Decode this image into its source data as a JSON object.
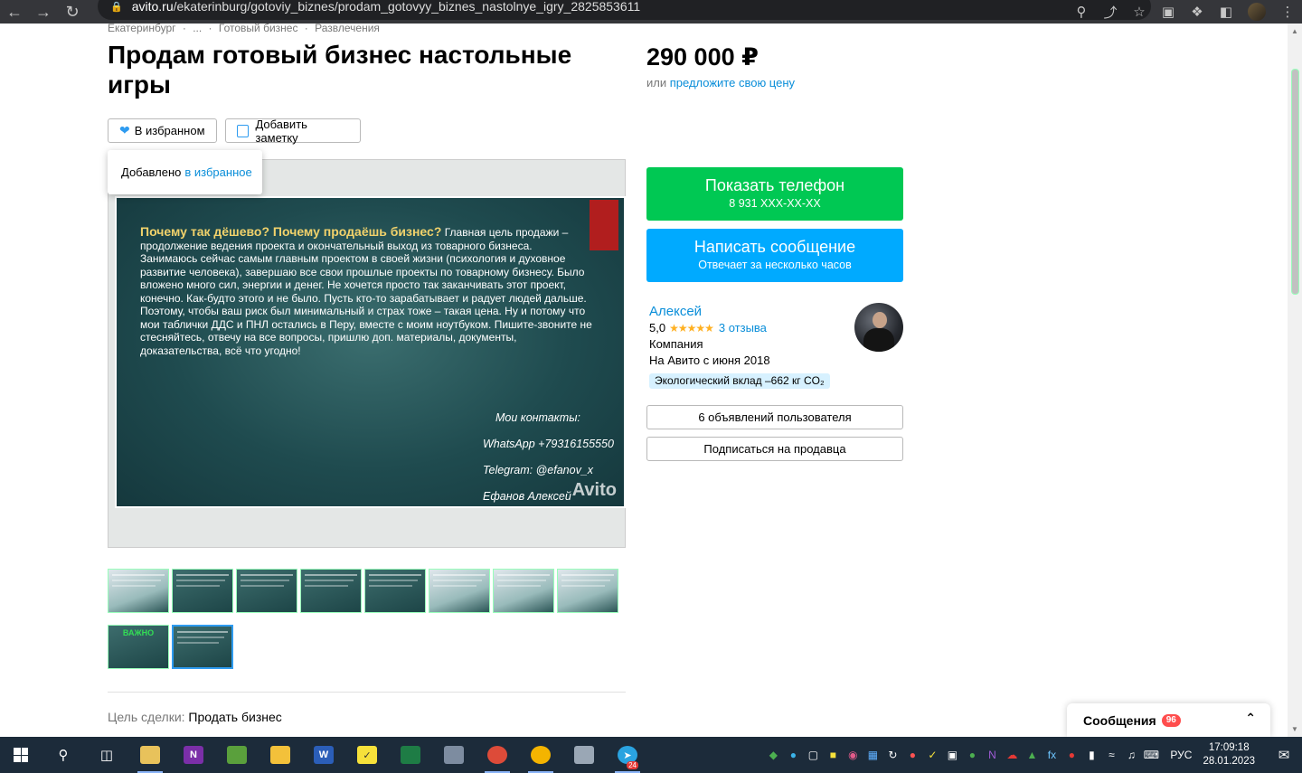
{
  "browser": {
    "url_host": "avito.ru",
    "url_path": "/ekaterinburg/gotoviy_biznes/prodam_gotovyy_biznes_nastolnye_igry_2825853611"
  },
  "breadcrumb": [
    "Екатеринбург",
    "·",
    "...",
    "·",
    "Готовый бизнес",
    "·",
    "Развлечения"
  ],
  "listing": {
    "title": "Продам готовый бизнес настольные игры",
    "price": "290 000 ₽",
    "price_prefix": "или",
    "price_offer_link": "предложите свою цену",
    "favorite_label": "В избранном",
    "note_label": "Добавить заметку",
    "tooltip_text": "Добавлено",
    "tooltip_link": "в избранное",
    "goal_label": "Цель сделки:",
    "goal_value": "Продать бизнес"
  },
  "slide": {
    "headline": "Почему так дёшево? Почему продаёшь бизнес?",
    "body": "Главная цель продажи – продолжение ведения проекта и окончательный выход из товарного бизнеса. Занимаюсь сейчас самым главным проектом в своей жизни (психология и духовное развитие человека), завершаю все свои прошлые проекты по товарному бизнесу. Было вложено много сил, энергии и денег. Не хочется просто так заканчивать этот проект, конечно. Как-будто этого и не было. Пусть кто-то зарабатывает и радует людей дальше. Поэтому, чтобы ваш риск был минимальный и страх тоже – такая цена. Ну и потому что мои таблички ДДС и ПНЛ остались в Перу, вместе с моим ноутбуком. Пишите-звоните не стесняйтесь, отвечу на все вопросы, пришлю доп. материалы, документы, доказательства, всё что угодно!",
    "contacts_title": "Мои контакты:",
    "whatsapp": "WhatsApp +79316155550",
    "telegram": "Telegram: @efanov_x",
    "name": "Ефанов Алексей",
    "watermark": "Avito"
  },
  "thumbnails": [
    {
      "style": "light",
      "label": ""
    },
    {
      "style": "dark",
      "label": ""
    },
    {
      "style": "dark",
      "label": ""
    },
    {
      "style": "dark",
      "label": ""
    },
    {
      "style": "dark",
      "label": ""
    },
    {
      "style": "light",
      "label": ""
    },
    {
      "style": "light",
      "label": ""
    },
    {
      "style": "light",
      "label": ""
    },
    {
      "style": "dark",
      "label": "ВАЖНО"
    },
    {
      "style": "dark",
      "label": "",
      "active": true
    }
  ],
  "contact": {
    "phone_button": "Показать телефон",
    "phone_masked": "8 931 XXX-XX-XX",
    "message_button": "Написать сообщение",
    "message_sub": "Отвечает за несколько часов",
    "phone_color": "#00c853",
    "message_color": "#00aaff"
  },
  "seller": {
    "name": "Алексей",
    "rating": "5,0",
    "stars": "★★★★★",
    "reviews": "3 отзыва",
    "type": "Компания",
    "since": "На Авито с июня 2018",
    "eco": "Экологический вклад –662 кг CO₂",
    "ads_button": "6 объявлений пользователя",
    "subscribe_button": "Подписаться на продавца"
  },
  "messages": {
    "label": "Сообщения",
    "count": "96"
  },
  "taskbar": {
    "lang": "РУС",
    "time": "17:09:18",
    "date": "28.01.2023",
    "telegram_badge": "24"
  }
}
